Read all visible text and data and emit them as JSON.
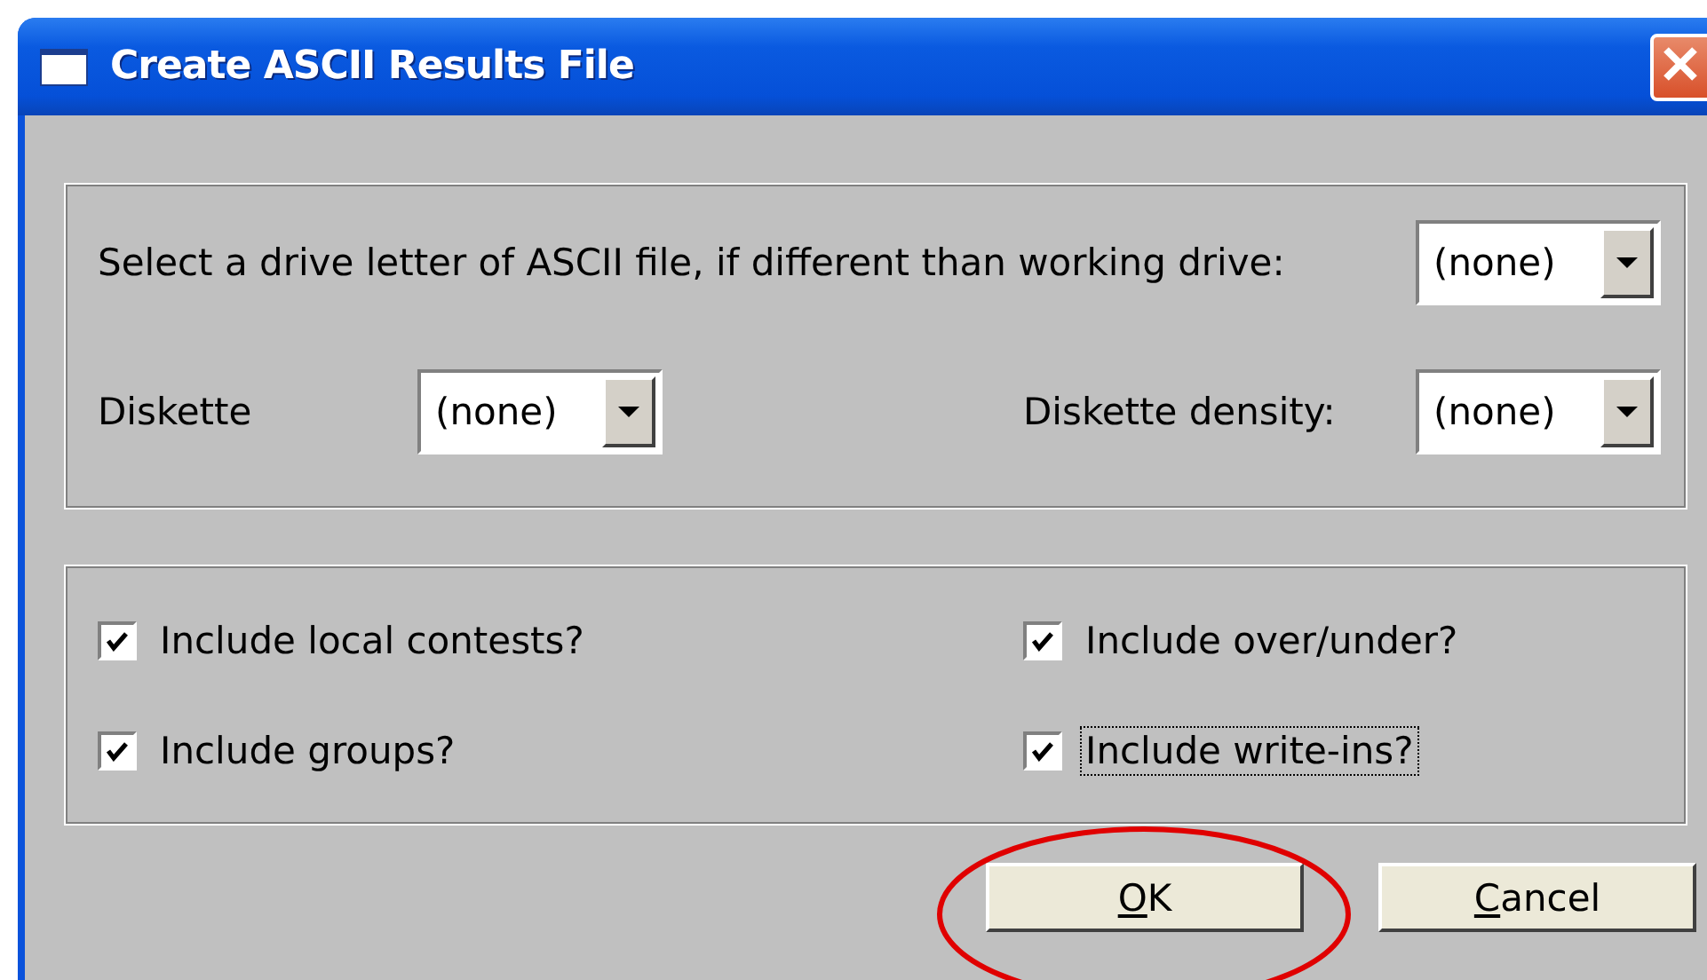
{
  "window": {
    "title": "Create ASCII Results File"
  },
  "drive_select": {
    "label": "Select a drive letter of ASCII file, if different than working drive:",
    "value": "(none)"
  },
  "diskette": {
    "label": "Diskette",
    "value": "(none)"
  },
  "diskette_density": {
    "label": "Diskette density:",
    "value": "(none)"
  },
  "options": [
    {
      "label": "Include local contests?",
      "checked": true,
      "focused": false
    },
    {
      "label": "Include over/under?",
      "checked": true,
      "focused": false
    },
    {
      "label": "Include groups?",
      "checked": true,
      "focused": false
    },
    {
      "label": "Include write-ins?",
      "checked": true,
      "focused": true
    }
  ],
  "buttons": [
    {
      "accel": "O",
      "rest": "K"
    },
    {
      "accel": "C",
      "rest": "ancel"
    }
  ],
  "highlight": {
    "kind": "ellipse"
  }
}
